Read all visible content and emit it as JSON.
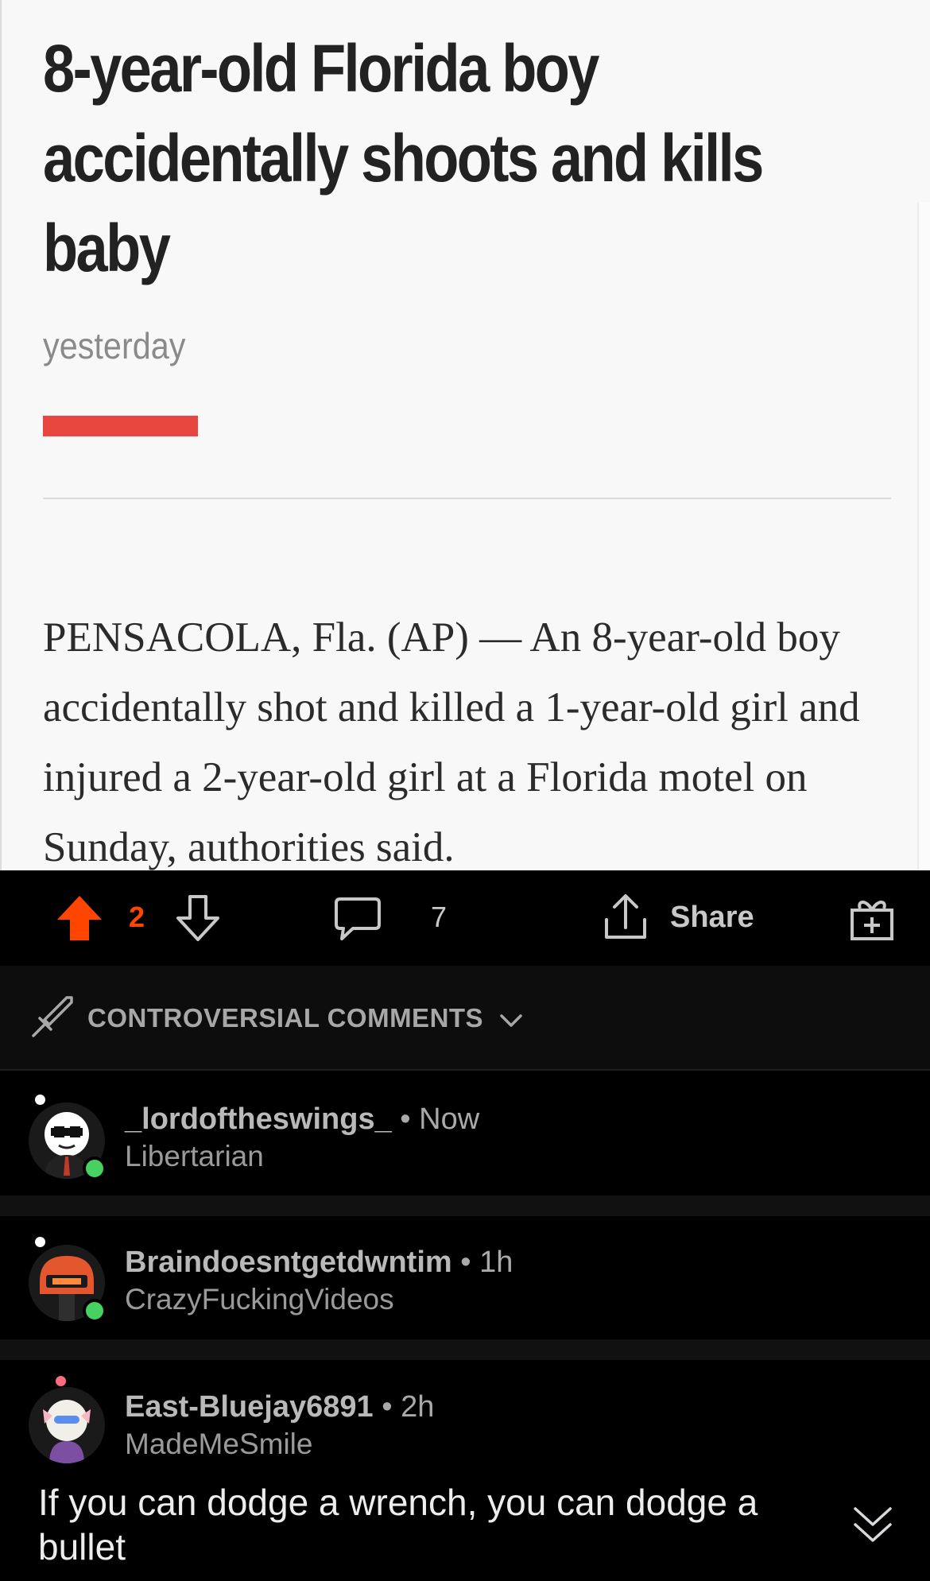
{
  "article": {
    "headline": "8-year-old Florida boy accidentally shoots and kills baby",
    "dateline": "yesterday",
    "body": "PENSACOLA, Fla. (AP) — An 8-year-old boy accidentally shot and killed a 1-year-old girl and injured a 2-year-old girl at a Florida motel on Sunday, authorities said."
  },
  "actions": {
    "vote_count": "2",
    "comment_count": "7",
    "share_label": "Share"
  },
  "sort": {
    "label": "CONTROVERSIAL COMMENTS"
  },
  "comments": [
    {
      "username": "_lordoftheswings_",
      "time": "Now",
      "community": "Libertarian"
    },
    {
      "username": "Braindoesntgetdwntim",
      "time": "1h",
      "community": "CrazyFuckingVideos"
    },
    {
      "username": "East-Bluejay6891",
      "time": "2h",
      "community": "MadeMeSmile",
      "text": "If you can dodge a wrench, you can dodge a bullet"
    }
  ],
  "colors": {
    "upvote": "#ff4500",
    "online": "#46d160",
    "accent_red": "#e8473f"
  },
  "icons": [
    "upvote-icon",
    "downvote-icon",
    "comment-icon",
    "share-icon",
    "award-icon",
    "sword-icon",
    "chevron-down-icon",
    "collapse-icon"
  ]
}
